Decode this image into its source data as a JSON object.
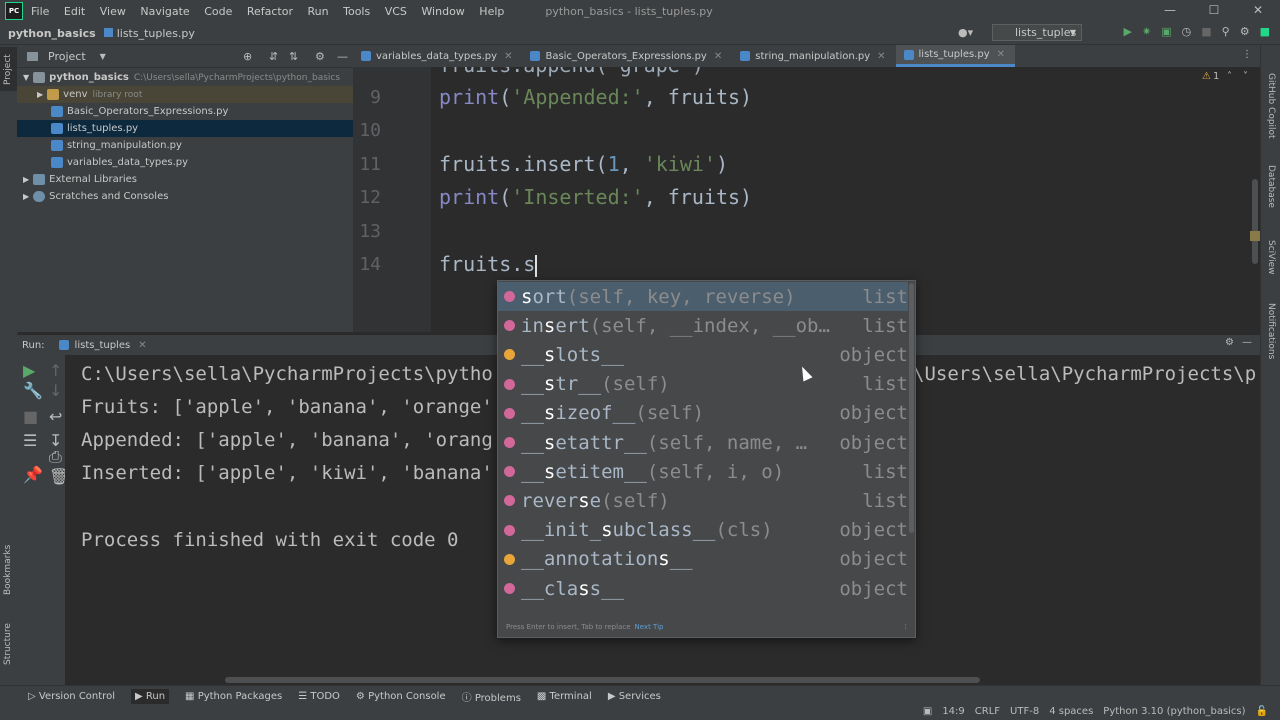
{
  "window": {
    "title": "python_basics - lists_tuples.py",
    "menu": [
      "File",
      "Edit",
      "View",
      "Navigate",
      "Code",
      "Refactor",
      "Run",
      "Tools",
      "VCS",
      "Window",
      "Help"
    ],
    "logo": "PC"
  },
  "navbar": {
    "project": "python_basics",
    "file": "lists_tuples.py",
    "run_config": "lists_tuples"
  },
  "project_panel": {
    "header": "Project",
    "root": {
      "name": "python_basics",
      "path": "C:\\Users\\sella\\PycharmProjects\\python_basics"
    },
    "venv": {
      "name": "venv",
      "note": "library root"
    },
    "files": [
      "Basic_Operators_Expressions.py",
      "lists_tuples.py",
      "string_manipulation.py",
      "variables_data_types.py"
    ],
    "external": "External Libraries",
    "scratches": "Scratches and Consoles"
  },
  "tabs": [
    {
      "label": "variables_data_types.py"
    },
    {
      "label": "Basic_Operators_Expressions.py"
    },
    {
      "label": "string_manipulation.py"
    },
    {
      "label": "lists_tuples.py"
    }
  ],
  "editor": {
    "warning_count": "1",
    "lines": [
      {
        "num": "9",
        "text": "print('Appended:', fruits)"
      },
      {
        "num": "10",
        "text": ""
      },
      {
        "num": "11",
        "text": "fruits.insert(1, 'kiwi')"
      },
      {
        "num": "12",
        "text": "print('Inserted:', fruits)"
      },
      {
        "num": "13",
        "text": ""
      },
      {
        "num": "14",
        "text": "fruits.s"
      }
    ]
  },
  "completion": {
    "items": [
      {
        "pre": "",
        "match": "s",
        "post": "ort",
        "sig": "(self, key, reverse)",
        "type": "list",
        "kind": "method"
      },
      {
        "pre": "in",
        "match": "s",
        "post": "ert",
        "sig": "(self, __index, __ob…",
        "type": "list",
        "kind": "method"
      },
      {
        "pre": "__",
        "match": "s",
        "post": "lots__",
        "sig": "",
        "type": "object",
        "kind": "field"
      },
      {
        "pre": "__",
        "match": "s",
        "post": "tr__",
        "sig": "(self)",
        "type": "list",
        "kind": "method"
      },
      {
        "pre": "__",
        "match": "s",
        "post": "izeof__",
        "sig": "(self)",
        "type": "object",
        "kind": "method"
      },
      {
        "pre": "__",
        "match": "s",
        "post": "etattr__",
        "sig": "(self, name, …",
        "type": "object",
        "kind": "method"
      },
      {
        "pre": "__",
        "match": "s",
        "post": "etitem__",
        "sig": "(self, i, o)",
        "type": "list",
        "kind": "method"
      },
      {
        "pre": "rever",
        "match": "s",
        "post": "e",
        "sig": "(self)",
        "type": "list",
        "kind": "method"
      },
      {
        "pre": "__init_",
        "match": "s",
        "post": "ubclass__",
        "sig": "(cls)",
        "type": "object",
        "kind": "method"
      },
      {
        "pre": "__annotation",
        "match": "s",
        "post": "__",
        "sig": "",
        "type": "object",
        "kind": "field"
      },
      {
        "pre": "__cla",
        "match": "s",
        "post": "s__",
        "sig": "",
        "type": "object",
        "kind": "method"
      }
    ],
    "footer": "Press Enter to insert, Tab to replace",
    "next_tip": "Next Tip"
  },
  "run_panel": {
    "label": "Run:",
    "tab": "lists_tuples",
    "output": [
      "C:\\Users\\sella\\PycharmProjects\\pytho",
      "Fruits: ['apple', 'banana', 'orange'",
      "Appended: ['apple', 'banana', 'orang",
      "Inserted: ['apple', 'kiwi', 'banana'",
      "",
      "Process finished with exit code 0"
    ],
    "output_tail": "\\Users\\sella\\PycharmProjects\\p"
  },
  "tool_windows": [
    "Version Control",
    "Run",
    "Python Packages",
    "TODO",
    "Python Console",
    "Problems",
    "Terminal",
    "Services"
  ],
  "status": {
    "position": "14:9",
    "line_sep": "CRLF",
    "encoding": "UTF-8",
    "indent": "4 spaces",
    "interpreter": "Python 3.10 (python_basics)"
  },
  "side_labels": {
    "left": [
      "Project",
      "Bookmarks",
      "Structure"
    ],
    "right": [
      "GitHub Copilot",
      "Database",
      "SciView",
      "Notifications"
    ]
  }
}
